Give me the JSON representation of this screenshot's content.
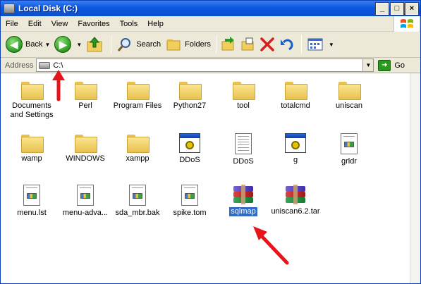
{
  "window": {
    "title": "Local Disk (C:)",
    "controls": [
      "_",
      "□",
      "×"
    ]
  },
  "menu": [
    "File",
    "Edit",
    "View",
    "Favorites",
    "Tools",
    "Help"
  ],
  "toolbar": {
    "back_label": "Back",
    "search_label": "Search",
    "folders_label": "Folders"
  },
  "address": {
    "label": "Address",
    "value": "C:\\",
    "go_label": "Go"
  },
  "items": [
    {
      "label": "Documents and Settings",
      "icon": "folder-icon"
    },
    {
      "label": "Perl",
      "icon": "folder-icon"
    },
    {
      "label": "Program Files",
      "icon": "folder-icon"
    },
    {
      "label": "Python27",
      "icon": "folder-icon"
    },
    {
      "label": "tool",
      "icon": "folder-icon"
    },
    {
      "label": "totalcmd",
      "icon": "folder-icon"
    },
    {
      "label": "uniscan",
      "icon": "folder-icon"
    },
    {
      "label": "wamp",
      "icon": "folder-icon"
    },
    {
      "label": "WINDOWS",
      "icon": "folder-icon"
    },
    {
      "label": "xampp",
      "icon": "folder-icon"
    },
    {
      "label": "DDoS",
      "icon": "executable-icon"
    },
    {
      "label": "DDoS",
      "icon": "text-document-icon"
    },
    {
      "label": "g",
      "icon": "executable-icon"
    },
    {
      "label": "grldr",
      "icon": "file-icon"
    },
    {
      "label": "menu.lst",
      "icon": "file-icon"
    },
    {
      "label": "menu-adva...",
      "icon": "file-icon"
    },
    {
      "label": "sda_mbr.bak",
      "icon": "file-icon"
    },
    {
      "label": "spike.tom",
      "icon": "file-icon"
    },
    {
      "label": "sqlmap",
      "icon": "winrar-archive-icon",
      "selected": true
    },
    {
      "label": "uniscan6.2.tar",
      "icon": "winrar-archive-icon"
    }
  ],
  "colors": {
    "titlebar": "#0b58e0",
    "selection": "#316ac5",
    "annotation_arrow": "#e8141c"
  }
}
